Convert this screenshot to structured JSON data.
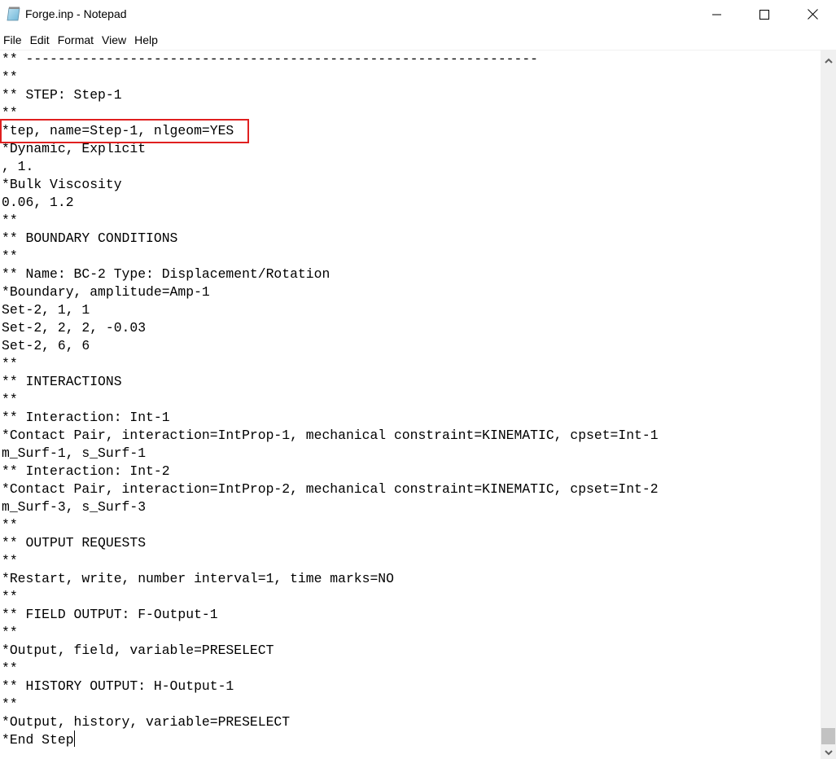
{
  "window": {
    "title": "Forge.inp - Notepad",
    "app_icon": "notepad-icon",
    "controls": [
      "minimize-icon",
      "maximize-icon",
      "close-icon"
    ]
  },
  "menu": {
    "items": [
      {
        "label": "File"
      },
      {
        "label": "Edit"
      },
      {
        "label": "Format"
      },
      {
        "label": "View"
      },
      {
        "label": "Help"
      }
    ]
  },
  "editor": {
    "highlighted_line_index": 4,
    "highlight_color": "#e02020",
    "caret_after_line_index": 38,
    "lines": [
      "** ----------------------------------------------------------------",
      "**",
      "** STEP: Step-1",
      "**",
      "*tep, name=Step-1, nlgeom=YES",
      "*Dynamic, Explicit",
      ", 1.",
      "*Bulk Viscosity",
      "0.06, 1.2",
      "**",
      "** BOUNDARY CONDITIONS",
      "**",
      "** Name: BC-2 Type: Displacement/Rotation",
      "*Boundary, amplitude=Amp-1",
      "Set-2, 1, 1",
      "Set-2, 2, 2, -0.03",
      "Set-2, 6, 6",
      "**",
      "** INTERACTIONS",
      "**",
      "** Interaction: Int-1",
      "*Contact Pair, interaction=IntProp-1, mechanical constraint=KINEMATIC, cpset=Int-1",
      "m_Surf-1, s_Surf-1",
      "** Interaction: Int-2",
      "*Contact Pair, interaction=IntProp-2, mechanical constraint=KINEMATIC, cpset=Int-2",
      "m_Surf-3, s_Surf-3",
      "**",
      "** OUTPUT REQUESTS",
      "**",
      "*Restart, write, number interval=1, time marks=NO",
      "**",
      "** FIELD OUTPUT: F-Output-1",
      "**",
      "*Output, field, variable=PRESELECT",
      "**",
      "** HISTORY OUTPUT: H-Output-1",
      "**",
      "*Output, history, variable=PRESELECT",
      "*End Step"
    ]
  },
  "scrollbar": {
    "position": "bottom"
  }
}
